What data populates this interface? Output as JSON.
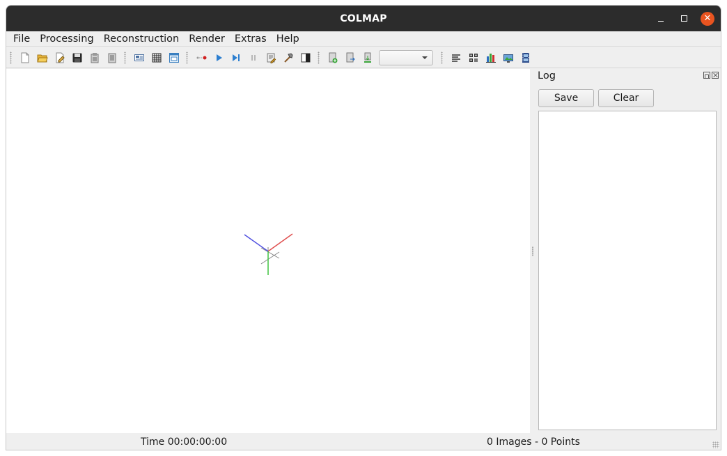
{
  "window": {
    "title": "COLMAP"
  },
  "titlebar_controls": [
    {
      "name": "minimize-button",
      "icon": "minimize-icon"
    },
    {
      "name": "maximize-button",
      "icon": "maximize-icon"
    },
    {
      "name": "close-button",
      "icon": "close-icon",
      "color": "#e95420",
      "glyph": "✕"
    }
  ],
  "menu": [
    "File",
    "Processing",
    "Reconstruction",
    "Render",
    "Extras",
    "Help"
  ],
  "toolbar": {
    "groups": [
      [
        "new-project-icon",
        "open-project-icon",
        "edit-project-icon",
        "save-project-icon",
        "import-model-icon",
        "export-model-icon"
      ],
      [
        "feature-extraction-icon",
        "feature-matching-icon",
        "database-management-icon"
      ],
      [
        "automatic-reconstruction-icon",
        "start-reconstruction-icon",
        "step-reconstruction-icon",
        "pause-reconstruction-icon",
        "reconstruction-options-icon",
        "bundle-adjustment-icon",
        "render-options-icon"
      ],
      [
        "add-model-icon",
        "export-all-icon",
        "import-all-icon"
      ],
      [
        "log-icon",
        "grid-icon",
        "statistics-icon",
        "screenshot-icon",
        "movie-grabber-icon"
      ]
    ],
    "model_select": {
      "selected": ""
    }
  },
  "viewport": {
    "axes_colors": {
      "x": "#e05050",
      "y": "#3fc23f",
      "z": "#5050e0",
      "grid": "#888888"
    }
  },
  "log": {
    "title": "Log",
    "save_label": "Save",
    "clear_label": "Clear",
    "content": ""
  },
  "status": {
    "time": "Time 00:00:00:00",
    "counts": "0 Images - 0 Points"
  }
}
